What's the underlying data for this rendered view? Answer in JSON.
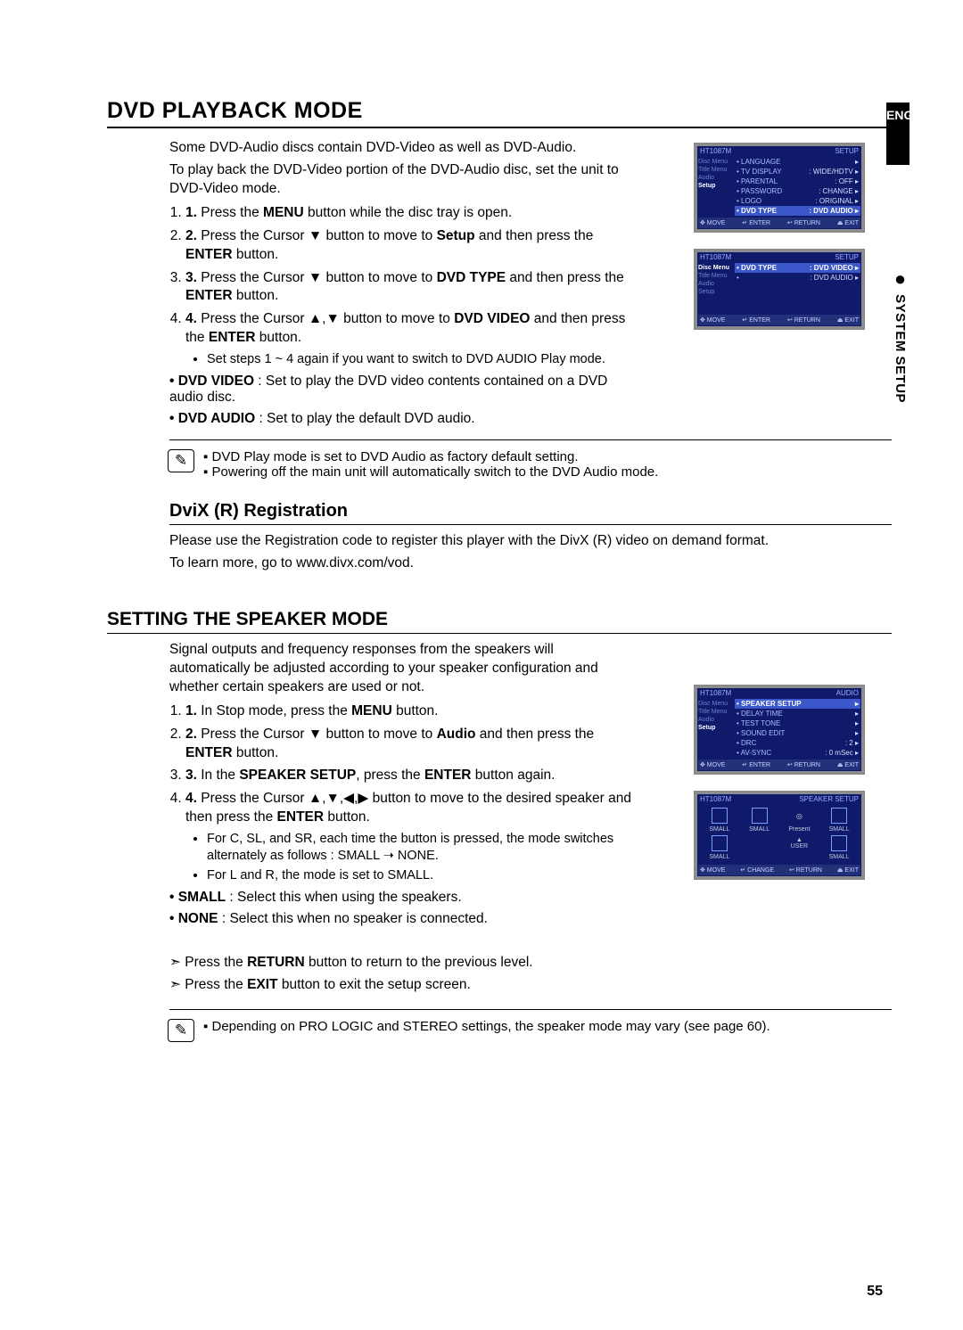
{
  "side": {
    "lang": "ENG",
    "section": "SYSTEM SETUP"
  },
  "page_number": "55",
  "h1": "DVD PLAYBACK MODE",
  "p1": "Some DVD-Audio discs contain DVD-Video as well as DVD-Audio.",
  "p2": "To play back the DVD-Video portion of the DVD-Audio disc, set the unit to DVD-Video mode.",
  "steps1": [
    "Press the MENU button while the disc tray is open.",
    "Press the Cursor ▼ button to move to Setup and then press the ENTER button.",
    "Press the Cursor ▼ button to move to DVD TYPE and then press the ENTER button.",
    "Press the Cursor ▲,▼ button to move to DVD VIDEO and then press the ENTER button."
  ],
  "sub1": "Set steps 1 ~ 4 again if you want to switch to DVD AUDIO Play mode.",
  "dvd_video": "DVD VIDEO : Set to play the DVD video contents contained on a DVD audio disc.",
  "dvd_audio": "DVD AUDIO : Set to play the default DVD audio.",
  "note1a": "DVD Play mode is set to DVD Audio as factory default setting.",
  "note1b": "Powering off the main unit will automatically switch to the DVD Audio mode.",
  "h3": "DviX (R) Registration",
  "divx1": "Please use the Registration code to register this player with the DivX (R) video on demand format.",
  "divx2": "To learn more, go to www.divx.com/vod.",
  "h2": "SETTING THE SPEAKER MODE",
  "spk_intro": "Signal outputs and frequency responses from the speakers will automatically be adjusted according to your speaker configuration and whether certain speakers are used or not.",
  "steps2": [
    "In Stop mode, press the MENU button.",
    "Press the Cursor ▼ button to move to Audio and then press the ENTER button.",
    "In the SPEAKER SETUP, press the ENTER button again.",
    "Press the Cursor ▲,▼,◀,▶ button to move to the desired speaker and then press the ENTER button."
  ],
  "sub2a": "For C, SL, and SR, each time the button is pressed, the mode switches alternately as follows : SMALL ➝ NONE.",
  "sub2b": "For L and R, the mode is set to SMALL.",
  "small": "SMALL : Select this when using the speakers.",
  "none": "NONE : Select this when no speaker is connected.",
  "ret": "Press the RETURN button to return to the previous level.",
  "exit": "Press the EXIT button to exit the setup screen.",
  "note2": "Depending on PRO LOGIC and STEREO settings, the speaker mode may vary (see page 60).",
  "osd": {
    "brand": "HT1087M",
    "setup": "SETUP",
    "audio": "AUDIO",
    "menu_side": [
      "Disc Menu",
      "Title Menu",
      "Audio",
      "Setup"
    ],
    "rows_setup": [
      {
        "lab": "LANGUAGE",
        "val": ""
      },
      {
        "lab": "TV DISPLAY",
        "val": "WIDE/HDTV"
      },
      {
        "lab": "PARENTAL",
        "val": "OFF"
      },
      {
        "lab": "PASSWORD",
        "val": "CHANGE"
      },
      {
        "lab": "LOGO",
        "val": "ORIGINAL"
      },
      {
        "lab": "DVD TYPE",
        "val": "DVD AUDIO",
        "hl": true
      }
    ],
    "rows_type": [
      {
        "lab": "DVD TYPE",
        "val": "DVD VIDEO",
        "hl": true
      },
      {
        "lab": "",
        "val": "DVD AUDIO"
      }
    ],
    "rows_audio": [
      {
        "lab": "SPEAKER SETUP",
        "val": "",
        "hl": true
      },
      {
        "lab": "DELAY TIME",
        "val": ""
      },
      {
        "lab": "TEST TONE",
        "val": ""
      },
      {
        "lab": "SOUND EDIT",
        "val": ""
      },
      {
        "lab": "DRC",
        "val": "2"
      },
      {
        "lab": "AV-SYNC",
        "val": "0 mSec"
      }
    ],
    "footer": [
      "MOVE",
      "ENTER",
      "RETURN",
      "EXIT"
    ],
    "footer2": [
      "MOVE",
      "CHANGE",
      "RETURN",
      "EXIT"
    ],
    "spk_title": "SPEAKER SETUP",
    "spk_labels": [
      "SMALL",
      "SMALL",
      "Present",
      "SMALL",
      "SMALL",
      "USER",
      "SMALL"
    ]
  }
}
